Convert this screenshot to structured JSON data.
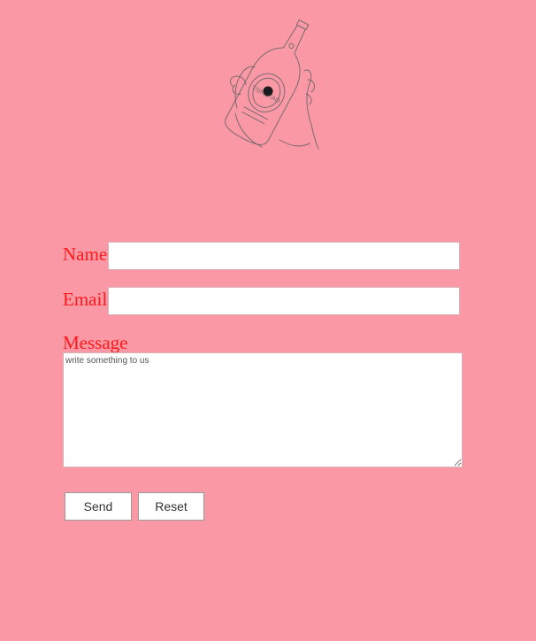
{
  "form": {
    "name_label": "Name",
    "email_label": "Email",
    "message_label": "Message",
    "name_value": "",
    "email_value": "",
    "message_placeholder": "write something to us",
    "send_label": "Send",
    "reset_label": "Reset"
  },
  "illustration": {
    "icon": "hand-holding-bottle-icon",
    "bottle_label": "TSINGTAO"
  },
  "colors": {
    "background": "#fb98a5",
    "label": "#ff1a1a",
    "line_art": "#7a6a6e"
  }
}
